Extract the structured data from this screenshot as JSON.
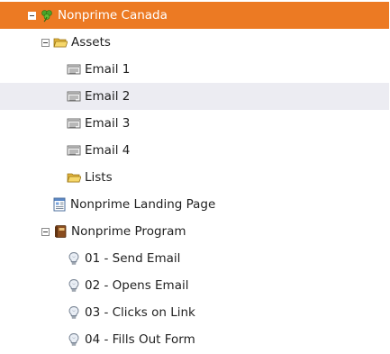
{
  "tree": {
    "root": {
      "label": "Nonprime Canada",
      "icon": "clover-workspace-icon",
      "state": "expanded",
      "selected": true
    },
    "assets": {
      "label": "Assets",
      "icon": "folder-open-icon",
      "state": "expanded"
    },
    "emails": [
      {
        "label": "Email 1",
        "icon": "email-icon"
      },
      {
        "label": "Email 2",
        "icon": "email-icon",
        "hovered": true
      },
      {
        "label": "Email 3",
        "icon": "email-icon"
      },
      {
        "label": "Email 4",
        "icon": "email-icon"
      }
    ],
    "lists": {
      "label": "Lists",
      "icon": "folder-icon"
    },
    "landing_page": {
      "label": "Nonprime Landing Page",
      "icon": "landing-page-icon"
    },
    "program": {
      "label": "Nonprime Program",
      "icon": "program-book-icon",
      "state": "expanded"
    },
    "campaigns": [
      {
        "label": "01 - Send Email",
        "icon": "lightbulb-icon"
      },
      {
        "label": "02 - Opens Email",
        "icon": "lightbulb-icon"
      },
      {
        "label": "03 - Clicks on Link",
        "icon": "lightbulb-icon"
      },
      {
        "label": "04 - Fills Out Form",
        "icon": "lightbulb-icon"
      }
    ]
  },
  "colors": {
    "selected_bg": "#ec7a23",
    "hover_bg": "#ececf2",
    "text": "#1f1f1f",
    "selected_text": "#ffffff"
  }
}
